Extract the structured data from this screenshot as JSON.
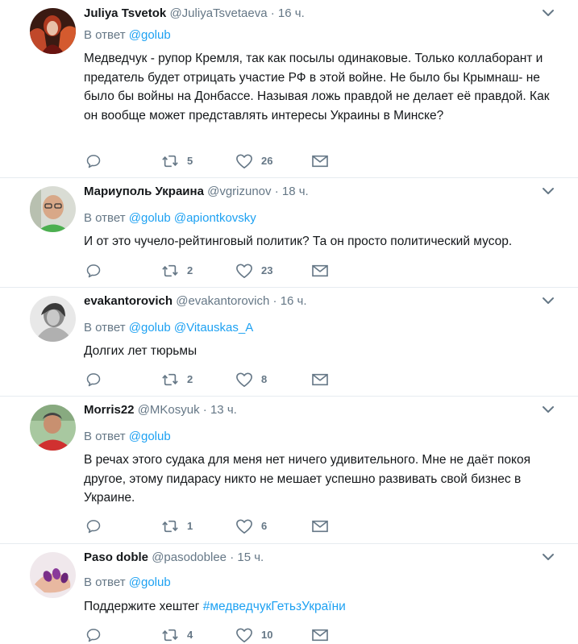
{
  "labels": {
    "reply_prefix": "В ответ"
  },
  "colors": {
    "link": "#1da1f2",
    "muted": "#657786",
    "text": "#14171a",
    "divider": "#e6ecf0"
  },
  "tweets": [
    {
      "name": "Juliya Tsvetok",
      "handle": "@JuliyaTsvetaeva",
      "time": "16 ч.",
      "mentions": [
        "@golub"
      ],
      "text": "Медведчук - рупор Кремля, так как посылы одинаковые. Только коллаборант и предатель будет отрицать участие РФ в этой войне. Не было бы Крымнаш- не было бы войны на Донбассе. Называя ложь правдой не делает её правдой. Как он вообще может представлять интересы Украины в Минске?",
      "retweets": "5",
      "likes": "26",
      "avatar_icon": "avatar-red-hair-icon"
    },
    {
      "name": "Мариуполь Украина",
      "handle": "@vgrizunov",
      "time": "18 ч.",
      "mentions": [
        "@golub",
        "@apiontkovsky"
      ],
      "text": "И от это чучело-рейтинговый политик? Та он просто политический мусор.",
      "retweets": "2",
      "likes": "23",
      "avatar_icon": "avatar-man-glasses-icon"
    },
    {
      "name": "evakantorovich",
      "handle": "@evakantorovich",
      "time": "16 ч.",
      "mentions": [
        "@golub",
        "@Vitauskas_A"
      ],
      "text": "Долгих лет тюрьмы",
      "retweets": "2",
      "likes": "8",
      "avatar_icon": "avatar-bw-portrait-icon"
    },
    {
      "name": "Morris22",
      "handle": "@MKosyuk",
      "time": "13 ч.",
      "mentions": [
        "@golub"
      ],
      "text": "В речах этого судака для меня нет ничего удивительного. Мне не даёт покоя другое, этому пидарасу никто не мешает успешно развивать свой бизнес в Украине.",
      "retweets": "1",
      "likes": "6",
      "avatar_icon": "avatar-man-red-shirt-icon"
    },
    {
      "name": "Paso doble",
      "handle": "@pasodoblee",
      "time": "15 ч.",
      "mentions": [
        "@golub"
      ],
      "text": "Поддержите хештег ",
      "hashtag": "#медведчукГетьзУкраїни",
      "retweets": "4",
      "likes": "10",
      "avatar_icon": "avatar-purple-nails-icon"
    }
  ]
}
